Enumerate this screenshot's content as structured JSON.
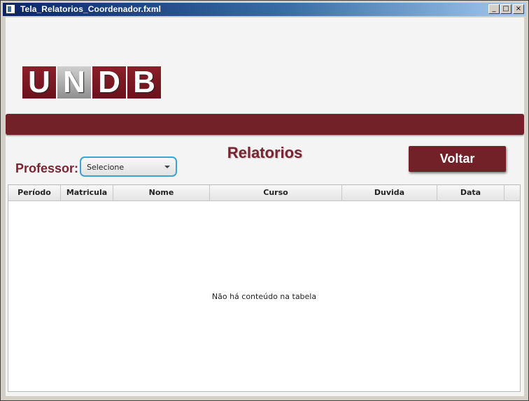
{
  "window": {
    "title": "Tela_Relatorios_Coordenador.fxml",
    "controls": {
      "minimize": "_",
      "maximize": "□",
      "close": "×"
    }
  },
  "logo": {
    "letters": [
      "U",
      "N",
      "D",
      "B"
    ]
  },
  "page": {
    "heading": "Relatorios",
    "professor_label": "Professor:",
    "professor_select": {
      "selected": "Selecione"
    },
    "back_button": "Voltar"
  },
  "table": {
    "columns": [
      "Período",
      "Matricula",
      "Nome",
      "Curso",
      "Duvida",
      "Data"
    ],
    "rows": [],
    "empty_message": "Não há conteúdo na tabela"
  },
  "colors": {
    "brand": "#722128",
    "heading": "#7a2432",
    "select_border": "#3fa3cf"
  }
}
